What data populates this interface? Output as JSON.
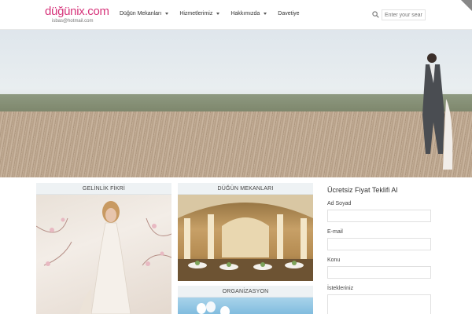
{
  "header": {
    "logo": "düğünix.com",
    "logo_email": "isbas@hotmail.com",
    "search_placeholder": "Enter your search"
  },
  "nav": {
    "items": [
      {
        "label": "Düğün Mekanları",
        "dropdown": true
      },
      {
        "label": "Hizmetlerimiz",
        "dropdown": true
      },
      {
        "label": "Hakkımızda",
        "dropdown": true
      },
      {
        "label": "Davetiye",
        "dropdown": false
      }
    ]
  },
  "cards": {
    "gelinlik": "GELİNLİK FİKRİ",
    "mekanlar": "DÜĞÜN MEKANLARI",
    "organizasyon": "ORGANİZASYON"
  },
  "form": {
    "title": "Ücretsiz Fiyat Teklifi Al",
    "fields": [
      {
        "label": "Ad Soyad"
      },
      {
        "label": "E-mail"
      },
      {
        "label": "Konu"
      },
      {
        "label": "İstekleriniz"
      }
    ]
  },
  "colors": {
    "brand": "#d6337a",
    "card_header_bg": "#eef2f4"
  },
  "icons": {
    "search": "search-icon",
    "caret": "chevron-down-icon"
  }
}
